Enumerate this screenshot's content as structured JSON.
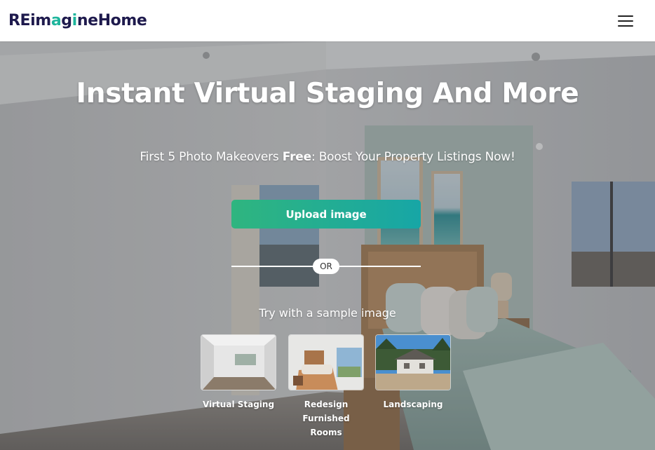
{
  "header": {
    "logo_part1": "REim",
    "logo_accent1": "a",
    "logo_part2": "g",
    "logo_accent2": "i",
    "logo_part3": "neHome",
    "menu_icon": "hamburger-menu-icon"
  },
  "hero": {
    "title": "Instant Virtual Staging And More",
    "subtitle_before": "First 5 Photo Makeovers ",
    "subtitle_bold": "Free",
    "subtitle_after": ": Boost Your Property Listings Now!",
    "upload_label": "Upload image",
    "or_label": "OR",
    "try_label": "Try with a sample image",
    "samples": [
      {
        "label": "Virtual Staging",
        "icon": "empty-room-thumbnail"
      },
      {
        "label": "Redesign Furnished Rooms",
        "icon": "bedroom-thumbnail"
      },
      {
        "label": "Landscaping",
        "icon": "house-exterior-thumbnail"
      }
    ]
  },
  "colors": {
    "brand_dark": "#1e1a4d",
    "brand_accent": "#1eb59c",
    "button_gradient_start": "#2fb57f",
    "button_gradient_end": "#17a6a6"
  }
}
